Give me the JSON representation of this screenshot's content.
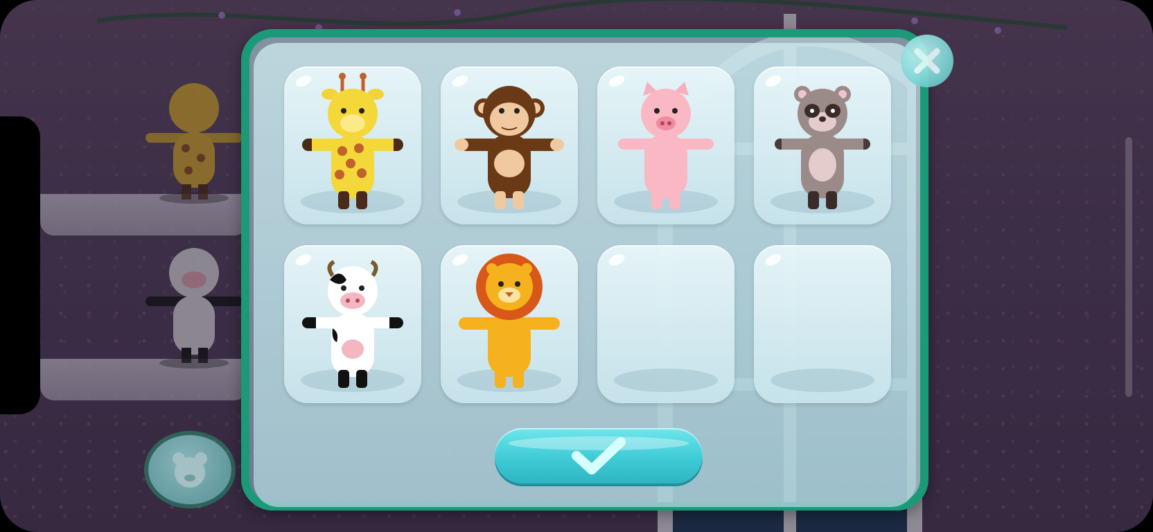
{
  "screen": "toy-selection",
  "colors": {
    "panel_border": "#1a9a78",
    "confirm_button": "#3fcbd6",
    "background": "#4f3d58"
  },
  "slots": [
    {
      "toy": "giraffe",
      "icon": "giraffe-icon",
      "filled": true
    },
    {
      "toy": "monkey",
      "icon": "monkey-icon",
      "filled": true
    },
    {
      "toy": "pig",
      "icon": "pig-icon",
      "filled": true
    },
    {
      "toy": "raccoon",
      "icon": "raccoon-icon",
      "filled": true
    },
    {
      "toy": "cow",
      "icon": "cow-icon",
      "filled": true
    },
    {
      "toy": "lion",
      "icon": "lion-icon",
      "filled": true
    },
    {
      "toy": "",
      "icon": "",
      "filled": false
    },
    {
      "toy": "",
      "icon": "",
      "filled": false
    }
  ],
  "background_shelf_toys": [
    "giraffe-icon",
    "cow-icon"
  ],
  "buttons": {
    "confirm_icon": "checkmark-icon",
    "close_icon": "close-icon",
    "menu_icon": "bear-icon"
  }
}
